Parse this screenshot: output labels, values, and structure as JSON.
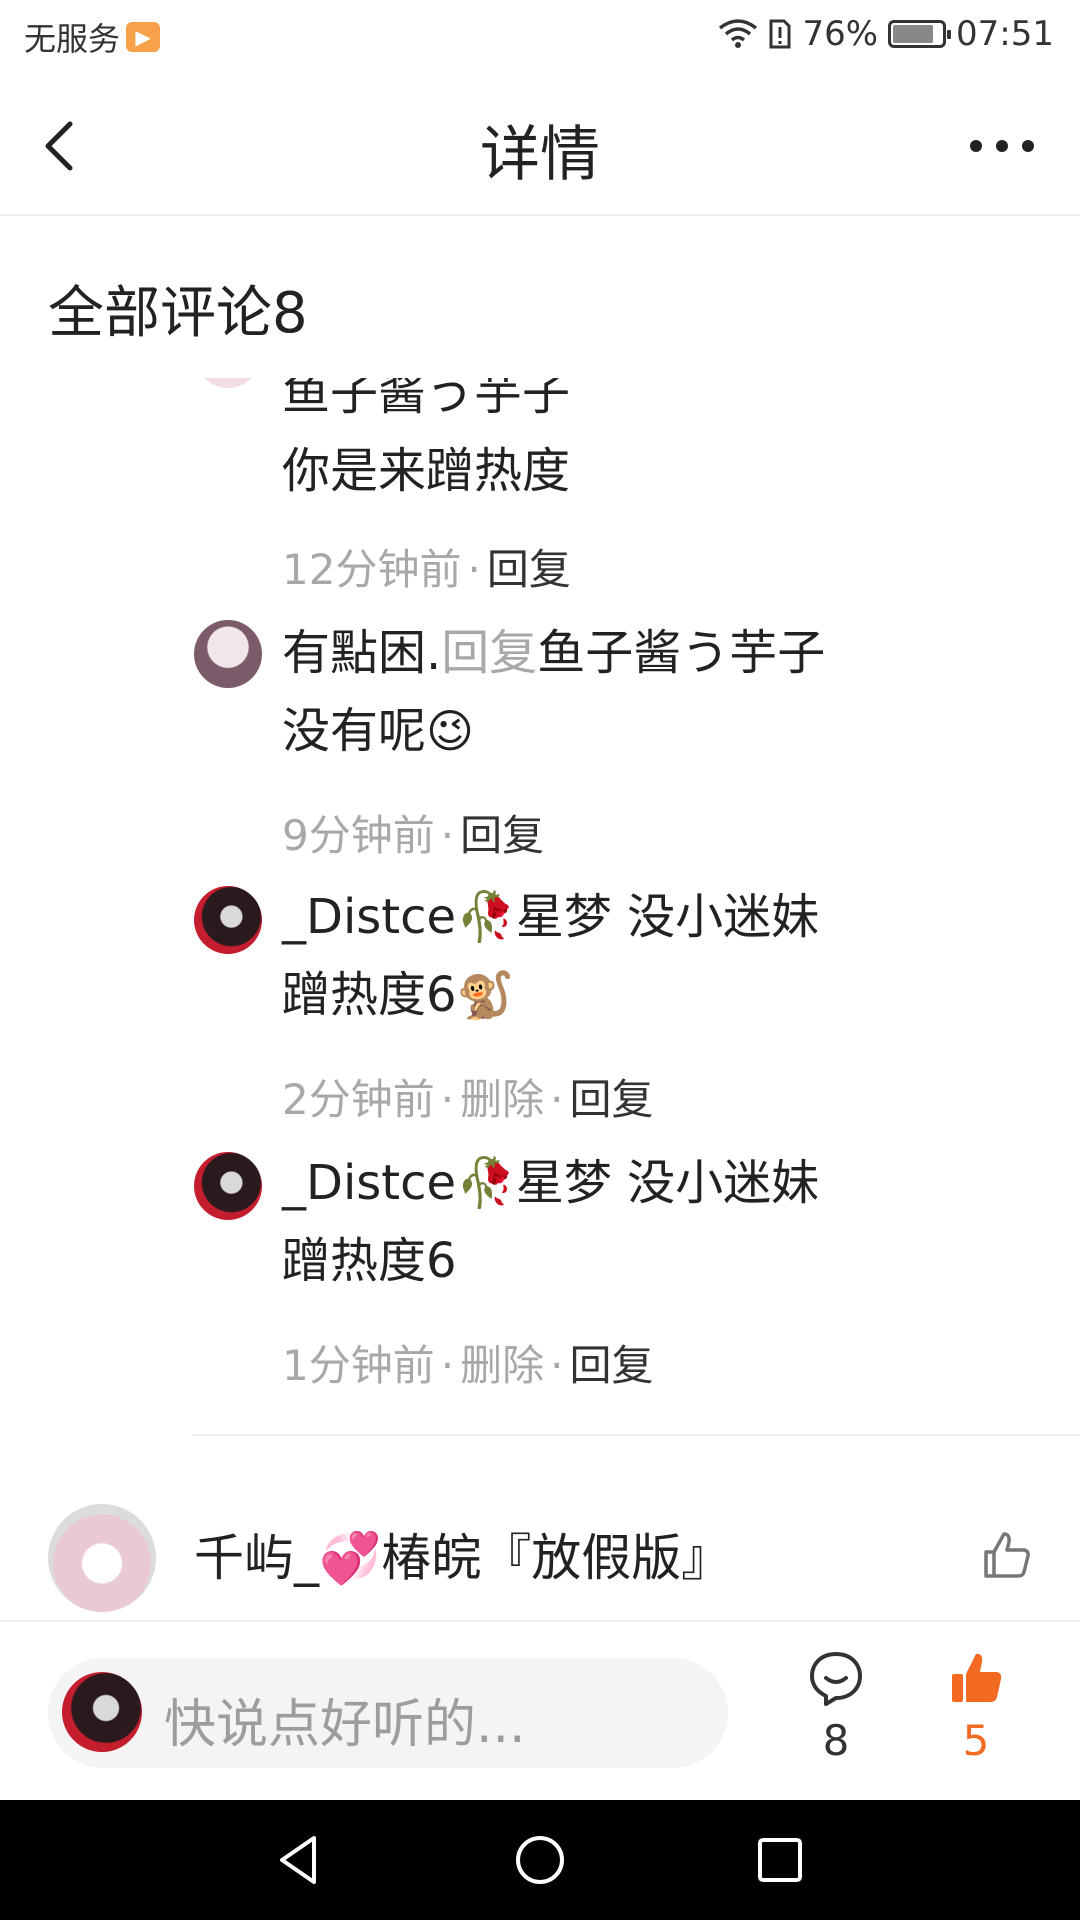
{
  "status_bar": {
    "carrier": "无服务",
    "battery_percent": "76%",
    "battery_level": 0.76,
    "time": "07:51"
  },
  "nav": {
    "title": "详情",
    "back_icon": "back-arrow-icon",
    "more_icon": "more-horizontal-icon"
  },
  "section": {
    "title": "全部评论8"
  },
  "replies": [
    {
      "partial_line": "鱼子酱う芋子",
      "text_lines": [
        "你是来蹭热度"
      ],
      "time": "12分钟前",
      "reply_label": "回复"
    },
    {
      "author": "有點困.",
      "reply_word": "回复",
      "target": "鱼子酱う芋子",
      "line2": "没有呢",
      "emoji": "😉",
      "time": "9分钟前",
      "reply_label": "回复"
    },
    {
      "author": "_Distce🥀星梦",
      "line1_rest": " 没小迷妹",
      "line2": "蹭热度6",
      "emoji": "🐒",
      "time": "2分钟前",
      "delete_label": "删除",
      "reply_label": "回复"
    },
    {
      "author": "_Distce🥀星梦",
      "line1_rest": " 没小迷妹",
      "line2": "蹭热度6",
      "time": "1分钟前",
      "delete_label": "删除",
      "reply_label": "回复"
    }
  ],
  "next_comment": {
    "author": "千屿_💞椿皖『放假版』"
  },
  "bottom_bar": {
    "placeholder": "快说点好听的...",
    "comment_count": "8",
    "like_count": "5",
    "like_color": "#f26a22"
  }
}
